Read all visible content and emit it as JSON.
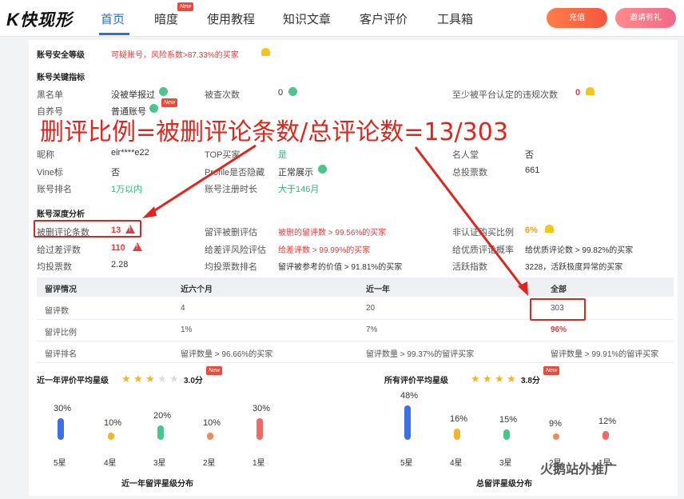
{
  "nav": {
    "logo": "快现形",
    "items": [
      "首页",
      "暗度",
      "使用教程",
      "知识文章",
      "客户评价",
      "工具箱"
    ],
    "new_tag": "New",
    "btn_recharge": "充值",
    "btn_invite": "邀请有礼"
  },
  "security": {
    "label": "账号安全等级",
    "value": "可疑账号，风险系数>87.33%的买家"
  },
  "key": {
    "title": "账号关键指标",
    "blacklist_label": "黑名单",
    "blacklist_value": "没被举报过",
    "checked_label": "被查次数",
    "checked_value": "0",
    "violation_label": "至少被平台认定的违规次数",
    "violation_value": "0",
    "self_label": "自养号",
    "self_value": "普通账号"
  },
  "overlay_text": "删评比例=被删评论条数/总评论数=13/303",
  "basic": {
    "r1": [
      "昵称",
      "eir****e22",
      "TOP买家",
      "是",
      "名人堂",
      "否"
    ],
    "r2": [
      "Vine标",
      "否",
      "Profile是否隐藏",
      "正常展示",
      "总投票数",
      "661"
    ],
    "r3": [
      "账号排名",
      "1万以内",
      "账号注册时长",
      "大于146月"
    ]
  },
  "deep": {
    "title": "账号深度分析",
    "deleted_label": "被删评论条数",
    "deleted_value": "13",
    "deleted_rate_label": "留评被删评估",
    "deleted_rate_value": "被删的留评数 > 99.56%的买家",
    "nonverified_label": "非认证购买比例",
    "nonverified_value": "6%",
    "bad_label": "给过差评数",
    "bad_value": "110",
    "bad_rate_label": "给差评风险评估",
    "bad_rate_value": "给差评数 > 99.99%的买家",
    "good_label": "给优质评论概率",
    "good_value": "给优质评论数 > 99.82%的买家",
    "avgvote_label": "均投票数",
    "avgvote_value": "2.28",
    "avgrank_label": "均投票数排名",
    "avgrank_value": "留评被参考的价值 > 91.81%的买家",
    "active_label": "活跃指数",
    "active_value": "3228，活跃极度异常的买家"
  },
  "table": {
    "headers": [
      "留评情况",
      "近六个月",
      "近一年",
      "全部"
    ],
    "rows": [
      [
        "留评数",
        "4",
        "20",
        "303"
      ],
      [
        "留评比例",
        "1%",
        "7%",
        "96%"
      ],
      [
        "留评排名",
        "留评数量 > 96.66%的买家",
        "留评数量 > 99.37%的留评买家",
        "留评数量 > 99.91%的留评买家"
      ]
    ]
  },
  "rating_year": {
    "label": "近一年评价平均星级",
    "value": "3.0分",
    "stars": 3,
    "title": "近一年留评星级分布"
  },
  "rating_all": {
    "label": "所有评价平均星级",
    "value": "3.8分",
    "stars": 4,
    "title": "总留评星级分布"
  },
  "chart_data": [
    {
      "type": "bar",
      "title": "近一年留评星级分布",
      "categories": [
        "5星",
        "4星",
        "3星",
        "2星",
        "1星"
      ],
      "values": [
        30,
        10,
        20,
        10,
        30
      ],
      "labels": [
        "30%",
        "10%",
        "20%",
        "10%",
        "30%"
      ],
      "colors": [
        "#3d6fe8",
        "#f5b32a",
        "#43c98c",
        "#f08a5d",
        "#f06868"
      ]
    },
    {
      "type": "bar",
      "title": "总留评星级分布",
      "categories": [
        "5星",
        "4星",
        "3星",
        "2星",
        "1星"
      ],
      "values": [
        48,
        16,
        15,
        9,
        12
      ],
      "labels": [
        "48%",
        "16%",
        "15%",
        "9%",
        "12%"
      ],
      "colors": [
        "#3d6fe8",
        "#f5b32a",
        "#43c98c",
        "#f08a5d",
        "#f06868"
      ]
    }
  ],
  "watermark": "火鹅站外推广"
}
